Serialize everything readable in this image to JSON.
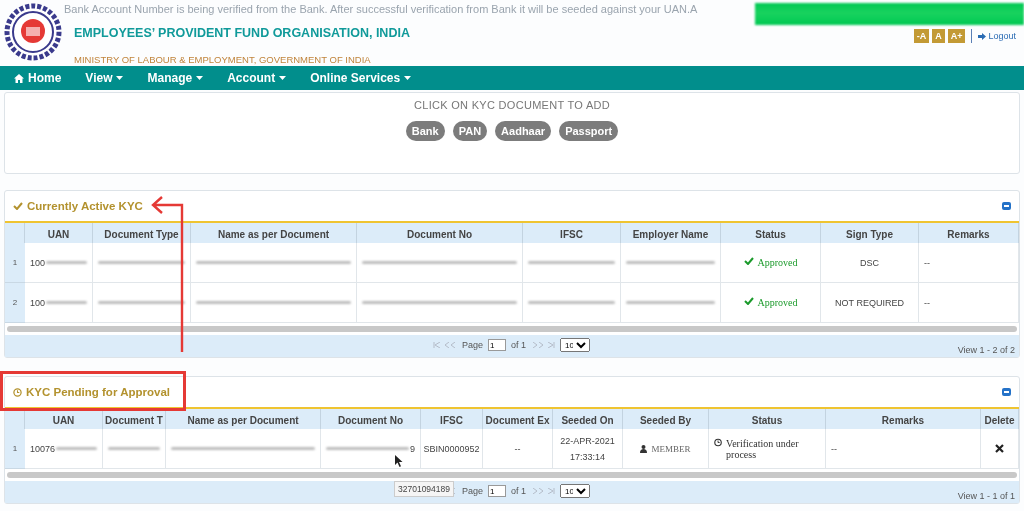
{
  "notice": "Bank Account Number is being verified from the Bank. After successful verification from Bank it will be seeded against your UAN.A",
  "header": {
    "title": "EMPLOYEES’ PROVIDENT FUND ORGANISATION, INDIA",
    "subtitle": "MINISTRY OF LABOUR & EMPLOYMENT, GOVERNMENT OF INDIA",
    "font_buttons": [
      "-A",
      "A",
      "A+"
    ],
    "logout": "Logout"
  },
  "nav": [
    {
      "label": "Home",
      "kind": "home"
    },
    {
      "label": "View",
      "kind": "dropdown"
    },
    {
      "label": "Manage",
      "kind": "dropdown"
    },
    {
      "label": "Account",
      "kind": "dropdown"
    },
    {
      "label": "Online Services",
      "kind": "dropdown"
    }
  ],
  "kyc_add": {
    "title": "CLICK ON KYC DOCUMENT TO ADD",
    "documents": [
      "Bank",
      "PAN",
      "Aadhaar",
      "Passport"
    ]
  },
  "sections": [
    {
      "title": "Currently Active KYC",
      "columns": [
        "UAN",
        "Document Type",
        "Name as per Document",
        "Document No",
        "IFSC",
        "Employer Name",
        "Status",
        "Sign Type",
        "Remarks"
      ],
      "rows": [
        {
          "number": "1",
          "cells": [
            {
              "kind": "redacted",
              "text": "100"
            },
            {
              "kind": "redacted"
            },
            {
              "kind": "redacted"
            },
            {
              "kind": "redacted"
            },
            {
              "kind": "redacted"
            },
            {
              "kind": "redacted"
            },
            {
              "kind": "approved",
              "text": "Approved"
            },
            {
              "kind": "text",
              "text": "DSC"
            },
            {
              "kind": "text",
              "text": "--"
            }
          ]
        },
        {
          "number": "2",
          "cells": [
            {
              "kind": "redacted",
              "text": "100"
            },
            {
              "kind": "redacted"
            },
            {
              "kind": "redacted"
            },
            {
              "kind": "redacted"
            },
            {
              "kind": "redacted"
            },
            {
              "kind": "redacted"
            },
            {
              "kind": "approved",
              "text": "Approved"
            },
            {
              "kind": "text",
              "text": "NOT REQUIRED"
            },
            {
              "kind": "text",
              "text": "--"
            }
          ]
        }
      ],
      "pager": {
        "page_label": "Page",
        "page": "1",
        "of": "of 1",
        "per_page": "10",
        "view": "View 1 - 2 of 2"
      }
    },
    {
      "title": "KYC Pending for Approval",
      "columns": [
        "UAN",
        "Document T",
        "Name as per Document",
        "Document No",
        "IFSC",
        "Document Ex",
        "Seeded On",
        "Seeded By",
        "Status",
        "Remarks",
        "Delete"
      ],
      "rows": [
        {
          "number": "1",
          "cells": [
            {
              "kind": "redacted",
              "text": "10076"
            },
            {
              "kind": "redacted"
            },
            {
              "kind": "redacted"
            },
            {
              "kind": "redacted_tail",
              "text": "9"
            },
            {
              "kind": "text",
              "text": "SBIN0000952"
            },
            {
              "kind": "text",
              "text": "--"
            },
            {
              "kind": "lines",
              "lines": [
                "22-APR-2021",
                "17:33:14"
              ]
            },
            {
              "kind": "user",
              "text": "MEMBER"
            },
            {
              "kind": "pending",
              "text": "Verification under process"
            },
            {
              "kind": "text",
              "text": "--"
            },
            {
              "kind": "delete"
            }
          ]
        }
      ],
      "pager": {
        "page_label": "Page",
        "page": "1",
        "of": "of 1",
        "per_page": "10",
        "view": "View 1 - 1 of 1"
      },
      "tooltip": "32701094189"
    }
  ]
}
